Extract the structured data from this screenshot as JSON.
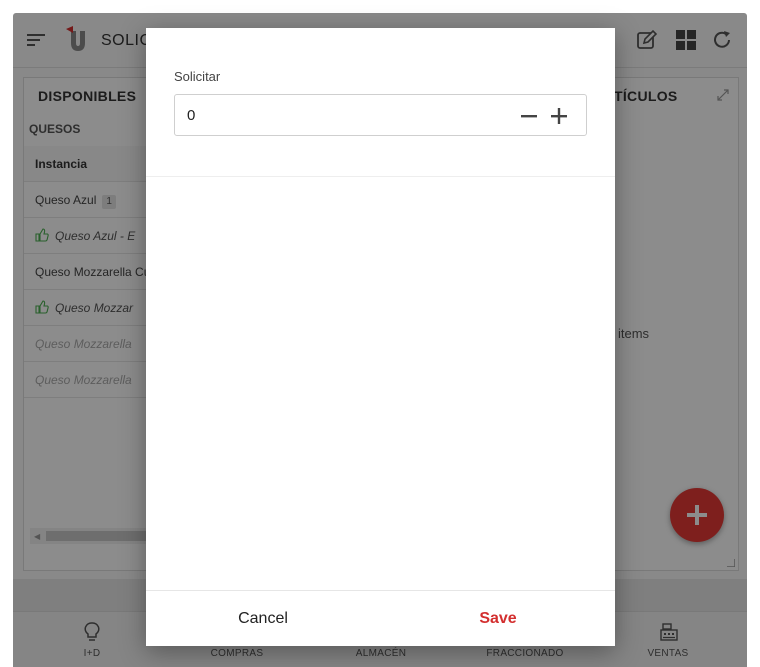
{
  "app": {
    "title": "SOLIC"
  },
  "left_panel": {
    "title": "DISPONIBLES",
    "group": "QUESOS",
    "header": "Instancia",
    "rows": [
      {
        "text": "Queso Azul",
        "badge": "1"
      },
      {
        "text": "Queso Azul - E"
      },
      {
        "text": "Queso Mozzarella Cu"
      },
      {
        "text": "Queso Mozzar"
      },
      {
        "text": "Queso Mozzarella"
      },
      {
        "text": "Queso Mozzarella"
      }
    ]
  },
  "right_panel": {
    "title": "TÍCULOS",
    "empty_text": "items"
  },
  "bottom_nav": [
    {
      "label": "I+D",
      "icon": "lightbulb-icon"
    },
    {
      "label": "COMPRAS",
      "icon": "cart-icon"
    },
    {
      "label": "ALMACÉN",
      "icon": "warehouse-icon"
    },
    {
      "label": "FRACCIONADO",
      "icon": "scale-icon"
    },
    {
      "label": "VENTAS",
      "icon": "cash-register-icon"
    }
  ],
  "modal": {
    "field_label": "Solicitar",
    "field_value": "0",
    "cancel_label": "Cancel",
    "save_label": "Save"
  },
  "colors": {
    "accent": "#d32f2f",
    "fab": "#e53935",
    "scrim": "rgba(0,0,0,0.45)"
  }
}
